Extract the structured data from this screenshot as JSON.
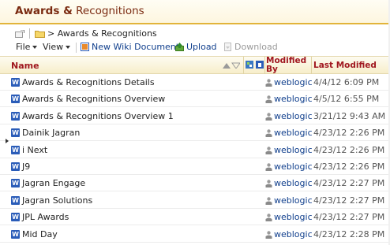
{
  "page": {
    "title_bold": "Awards &",
    "title_rest": " Recognitions"
  },
  "breadcrumb": {
    "text": "> Awards & Recognitions"
  },
  "toolbar": {
    "file_label": "File",
    "view_label": "View",
    "new_wiki_label": "New Wiki Document",
    "upload_label": "Upload",
    "download_label": "Download"
  },
  "columns": {
    "name": "Name",
    "modified_by_1": "Modified",
    "modified_by_2": "By",
    "last_modified": "Last Modified"
  },
  "documents": [
    {
      "name": "Awards & Recognitions Details",
      "modified_by": "weblogic",
      "last_modified": "4/4/12 6:09 PM"
    },
    {
      "name": "Awards & Recognitions Overview",
      "modified_by": "weblogic",
      "last_modified": "4/5/12 6:55 PM"
    },
    {
      "name": "Awards & Recognitions Overview 1",
      "modified_by": "weblogic",
      "last_modified": "3/21/12 9:43 AM"
    },
    {
      "name": "Dainik Jagran",
      "modified_by": "weblogic",
      "last_modified": "4/23/12 2:26 PM"
    },
    {
      "name": "i Next",
      "modified_by": "weblogic",
      "last_modified": "4/23/12 2:26 PM"
    },
    {
      "name": "J9",
      "modified_by": "weblogic",
      "last_modified": "4/23/12 2:26 PM"
    },
    {
      "name": "Jagran Engage",
      "modified_by": "weblogic",
      "last_modified": "4/23/12 2:27 PM"
    },
    {
      "name": "Jagran Solutions",
      "modified_by": "weblogic",
      "last_modified": "4/23/12 2:27 PM"
    },
    {
      "name": "JPL Awards",
      "modified_by": "weblogic",
      "last_modified": "4/23/12 2:27 PM"
    },
    {
      "name": "Mid Day",
      "modified_by": "weblogic",
      "last_modified": "4/23/12 2:28 PM"
    }
  ],
  "icons": {
    "doc": "word-document-icon",
    "doc_glyph": "W",
    "user": "user-icon"
  },
  "colors": {
    "accent": "#e2b43a",
    "header_text": "#a0171f",
    "link": "#0f3e8c",
    "title_text": "#7a2a10"
  }
}
